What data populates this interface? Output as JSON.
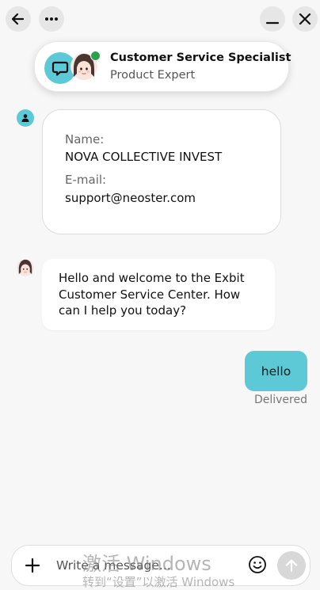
{
  "agent": {
    "name": "Customer Service Specialist",
    "role": "Product Expert",
    "status_color": "#2aa14b"
  },
  "info_card": {
    "name_label": "Name:",
    "name_value": "NOVA COLLECTIVE INVEST",
    "email_label": "E-mail:",
    "email_value": "support@neoster.com"
  },
  "messages": [
    {
      "sender": "agent",
      "text": "Hello and welcome to the Exbit Customer Service Center. How can I help you today?"
    },
    {
      "sender": "user",
      "text": "hello",
      "status": "Delivered"
    }
  ],
  "composer": {
    "placeholder": "Write a message..."
  },
  "watermark": {
    "line1": "激活 Windows",
    "line2": "转到“设置”以激活 Windows"
  },
  "icons": {
    "back": "arrow-left-icon",
    "more": "more-horizontal-icon",
    "minimize": "minimize-icon",
    "close": "close-icon",
    "chat": "chat-bubble-icon",
    "user": "user-icon",
    "add": "plus-icon",
    "emoji": "smiley-icon",
    "send": "arrow-up-icon"
  },
  "colors": {
    "accent": "#5ec9d6",
    "background": "#f7f7f7"
  }
}
